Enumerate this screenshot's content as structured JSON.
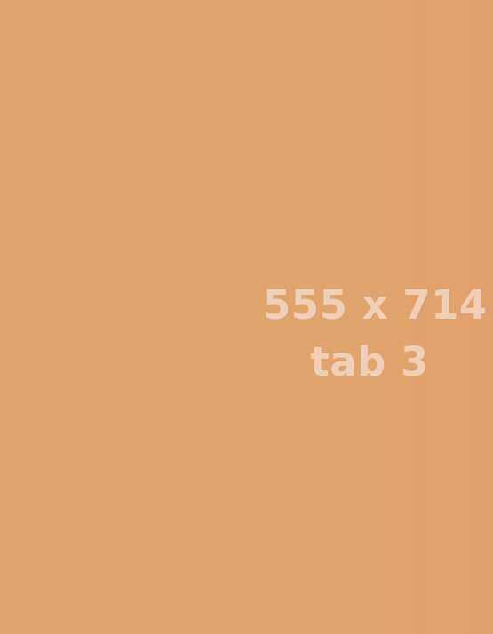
{
  "placeholder": {
    "dimensions_label": "555 x 714",
    "tab_label": "tab 3"
  },
  "colors": {
    "background": "#e0a36d",
    "text": "#efcfb6"
  }
}
